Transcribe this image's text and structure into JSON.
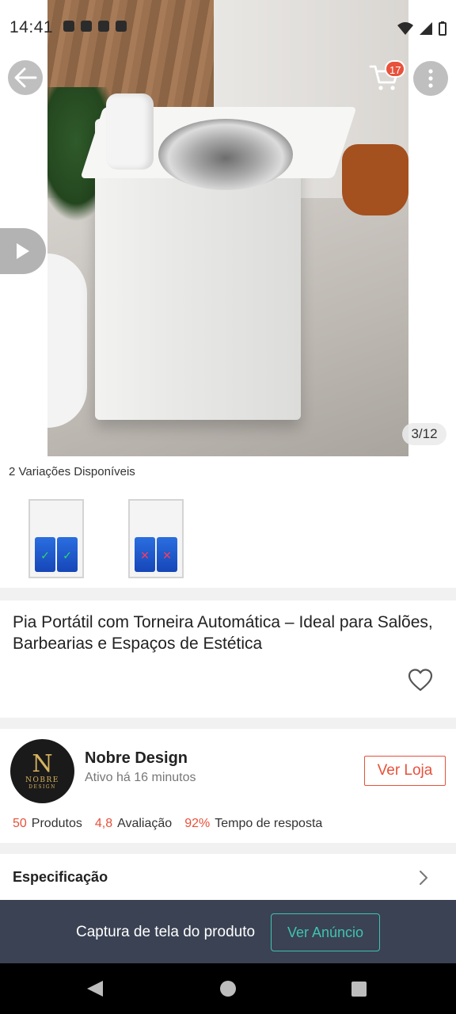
{
  "status_bar": {
    "time": "14:41"
  },
  "gallery": {
    "counter": "3/12",
    "cart_count": "17"
  },
  "variations": {
    "label": "2 Variações Disponíveis"
  },
  "product": {
    "title": "Pia Portátil com Torneira Automática – Ideal para Salões, Barbearias e Espaços de Estética"
  },
  "seller": {
    "logo_letter": "N",
    "logo_text": "NOBRE",
    "logo_subtext": "DESIGN",
    "name": "Nobre Design",
    "active": "Ativo há 16 minutos",
    "store_button": "Ver Loja",
    "stats": [
      {
        "value": "50",
        "label": "Produtos"
      },
      {
        "value": "4,8",
        "label": "Avaliação"
      },
      {
        "value": "92%",
        "label": "Tempo de resposta"
      }
    ]
  },
  "specification": {
    "label": "Especificação"
  },
  "banner": {
    "text": "Captura de tela do produto",
    "button": "Ver Anúncio"
  },
  "colors": {
    "accent": "#e8513b",
    "banner_bg": "#3a4253",
    "banner_button": "#3fc3b3"
  },
  "icons": [
    "back-arrow-icon",
    "cart-icon",
    "more-vertical-icon",
    "play-icon",
    "heart-icon",
    "chevron-right-icon"
  ]
}
